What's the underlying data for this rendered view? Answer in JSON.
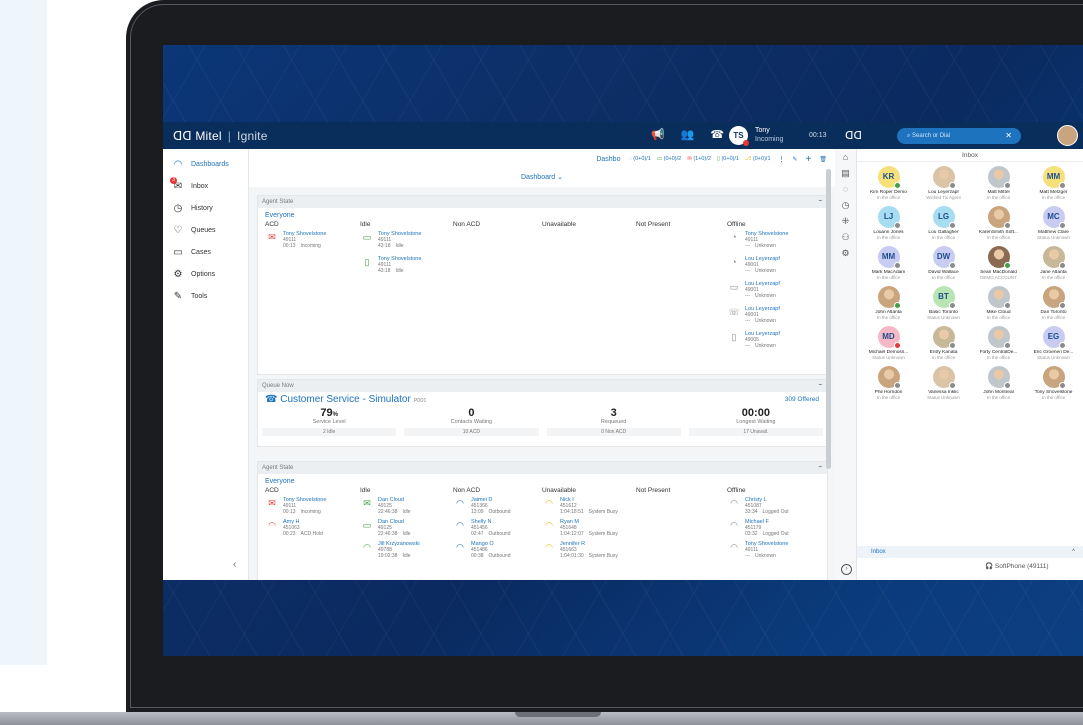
{
  "app": {
    "brand": "Mitel",
    "product": "Ignite",
    "user_initials": "TS",
    "user_name": "Tony",
    "user_status": "Incoming",
    "clock": "00:13"
  },
  "nav": [
    {
      "label": "Dashboards",
      "icon": "dashboard-icon",
      "glyph": "◠",
      "active": true
    },
    {
      "label": "Inbox",
      "icon": "inbox-icon",
      "glyph": "✉",
      "badge": "3"
    },
    {
      "label": "History",
      "icon": "history-icon",
      "glyph": "◷"
    },
    {
      "label": "Queues",
      "icon": "queues-icon",
      "glyph": "♡"
    },
    {
      "label": "Cases",
      "icon": "cases-icon",
      "glyph": "▭"
    },
    {
      "label": "Options",
      "icon": "options-icon",
      "glyph": "⚙"
    },
    {
      "label": "Tools",
      "icon": "tools-icon",
      "glyph": "✎"
    }
  ],
  "header": {
    "tab": "Dashbo",
    "counters": [
      "(0+0)/1",
      "(0+0)/2",
      "(1+0)/2",
      "(0+0)/1",
      "(0+0)/1"
    ],
    "subtitle": "Dashboard"
  },
  "panel1": {
    "title": "Agent State",
    "group": "Everyone",
    "columns": [
      "ACD",
      "Idle",
      "Non ACD",
      "Unavailable",
      "Not Present",
      "Offline"
    ],
    "acd": [
      {
        "name": "Tony Shovelstone",
        "ext": "49111",
        "t": "00:13",
        "s": "Incoming",
        "color": "#e53935",
        "glyph": "✉"
      }
    ],
    "idle": [
      {
        "name": "Tony Shovelstone",
        "ext": "49111",
        "t": "43:18",
        "s": "Idle",
        "color": "#43a047",
        "glyph": "▭"
      },
      {
        "name": "Tony Shovelstone",
        "ext": "49111",
        "t": "43:18",
        "s": "Idle",
        "color": "#43a047",
        "glyph": "▯"
      }
    ],
    "offline": [
      {
        "name": "Tony Shovelstone",
        "ext": "49111",
        "t": "---",
        "s": "Unknown",
        "glyph": "◔"
      },
      {
        "name": "Lou Leyerzapf",
        "ext": "49001",
        "t": "---",
        "s": "Unknown",
        "glyph": "◔"
      },
      {
        "name": "Lou Leyerzapf",
        "ext": "49001",
        "t": "---",
        "s": "Unknown",
        "glyph": "▭"
      },
      {
        "name": "Lou Leyerzapf",
        "ext": "49001",
        "t": "---",
        "s": "Unknown",
        "glyph": "☏"
      },
      {
        "name": "Lou Leyerzapf",
        "ext": "49005",
        "t": "---",
        "s": "Unknown",
        "glyph": "▯"
      }
    ]
  },
  "queue": {
    "panel_title": "Queue Now",
    "name": "Customer Service - Simulator",
    "code": "P001",
    "offered": "309 Offered",
    "stats": [
      {
        "num": "79",
        "unit": "%",
        "label": "Service Level",
        "sub": "2 Idle"
      },
      {
        "num": "0",
        "unit": "",
        "label": "Contacts Waiting",
        "sub": "10 ACD"
      },
      {
        "num": "3",
        "unit": "",
        "label": "Requeued",
        "sub": "0 Non ACD"
      },
      {
        "num": "00:00",
        "unit": "",
        "label": "Longest Waiting",
        "sub": "17 Unavail."
      }
    ]
  },
  "panel3": {
    "title": "Agent State",
    "group": "Everyone",
    "columns": [
      "ACD",
      "Idle",
      "Non ACD",
      "Unavailable",
      "Not Present",
      "Offline"
    ],
    "acd": [
      {
        "name": "Tony Shovelstone",
        "ext": "49111",
        "t": "00:13",
        "s": "Incoming",
        "color": "#e53935",
        "glyph": "✉"
      },
      {
        "name": "Amy H",
        "ext": "451063",
        "t": "00:23",
        "s": "ACD Hold",
        "color": "#e53935",
        "glyph": "◠"
      }
    ],
    "idle": [
      {
        "name": "Dan Cloud",
        "ext": "49125",
        "t": "22:46:38",
        "s": "Idle",
        "color": "#43a047",
        "glyph": "✉"
      },
      {
        "name": "Dan Cloud",
        "ext": "49125",
        "t": "22:46:38",
        "s": "Idle",
        "color": "#43a047",
        "glyph": "▭"
      },
      {
        "name": "Jill Krzyzanowski",
        "ext": "49788",
        "t": "19:02:38",
        "s": "Idle",
        "color": "#43a047",
        "glyph": "◠"
      }
    ],
    "nonacd": [
      {
        "name": "Jaimei D",
        "ext": "451366",
        "t": "13:09",
        "s": "Outbound",
        "color": "#1e73be",
        "glyph": "◠"
      },
      {
        "name": "Shelly N",
        "ext": "451456",
        "t": "02:47",
        "s": "Outbound",
        "color": "#1e73be",
        "glyph": "◠"
      },
      {
        "name": "Mango O",
        "ext": "451486",
        "t": "00:38",
        "s": "Outbound",
        "color": "#1e73be",
        "glyph": "◠"
      }
    ],
    "unavail": [
      {
        "name": "Nick I",
        "ext": "451612",
        "t": "1:04:18:51",
        "s": "System Busy",
        "color": "#f2b705",
        "glyph": "◠"
      },
      {
        "name": "Ryan M",
        "ext": "451648",
        "t": "1:04:12:07",
        "s": "System Busy",
        "color": "#f2b705",
        "glyph": "◠"
      },
      {
        "name": "Jennifer R",
        "ext": "451663",
        "t": "1:04:01:30",
        "s": "System Busy",
        "color": "#f2b705",
        "glyph": "◠"
      }
    ],
    "offline": [
      {
        "name": "Christy L",
        "ext": "451087",
        "t": "33:34",
        "s": "Logged Out",
        "glyph": "◠"
      },
      {
        "name": "Michael F",
        "ext": "451179",
        "t": "03:32",
        "s": "Logged Out",
        "glyph": "◠"
      },
      {
        "name": "Tony Shovelstone",
        "ext": "49111",
        "t": "---",
        "s": "Unknown",
        "glyph": "◠"
      }
    ]
  },
  "rightpanel": {
    "search_placeholder": "Search or Dial",
    "title": "Inbox",
    "footer": "Inbox",
    "softphone": "SoftPhone (49111)",
    "contacts": [
      {
        "name": "Kim Roper Demo",
        "status": "In the office",
        "init": "KR",
        "bg": "#f6e07a",
        "dot": "#43a047"
      },
      {
        "name": "Lou Leyerzapf",
        "status": "Wicked Tix Agent",
        "init": "",
        "bg": "#d9c4a8",
        "dot": "#8c8c8c"
      },
      {
        "name": "Matt Mittel",
        "status": "In the office",
        "init": "",
        "bg": "#bfc6cc",
        "dot": "#8c8c8c"
      },
      {
        "name": "Matt Metzger",
        "status": "In the office",
        "init": "MM",
        "bg": "#f6e07a",
        "dot": "#8c8c8c"
      },
      {
        "name": "Louann Jones",
        "status": "In the office",
        "init": "LJ",
        "bg": "#a8dcf0",
        "dot": "#8c8c8c"
      },
      {
        "name": "Lou Gallagher",
        "status": "In the office",
        "init": "LG",
        "bg": "#a8dcf0",
        "dot": "#8c8c8c"
      },
      {
        "name": "KarenSmith Soft...",
        "status": "In the office",
        "init": "",
        "bg": "#c8a57e",
        "dot": "#8c8c8c"
      },
      {
        "name": "Matthew Clare",
        "status": "Status Unknown",
        "init": "MC",
        "bg": "#c9ccf2",
        "dot": "#8c8c8c"
      },
      {
        "name": "Mark MacAdam",
        "status": "In the office",
        "init": "MM",
        "bg": "#c9ccf2",
        "dot": "#8c8c8c"
      },
      {
        "name": "David Wallace",
        "status": "In the office",
        "init": "DW",
        "bg": "#c9ccf2",
        "dot": "#8c8c8c"
      },
      {
        "name": "Sean MacDonald",
        "status": "DEMO ACCOUNT",
        "init": "",
        "bg": "#8a6b52",
        "dot": "#43a047"
      },
      {
        "name": "Jane Atlanta",
        "status": "In the office",
        "init": "",
        "bg": "#c8b89a",
        "dot": "#8c8c8c"
      },
      {
        "name": "John Atlanta",
        "status": "In the office",
        "init": "",
        "bg": "#c8a57e",
        "dot": "#43a047"
      },
      {
        "name": "Basic Toronto",
        "status": "Status Unknown",
        "init": "BT",
        "bg": "#b9e4b3",
        "dot": "#8c8c8c"
      },
      {
        "name": "Mike Cloud",
        "status": "In the office",
        "init": "",
        "bg": "#bfc6cc",
        "dot": "#8c8c8c"
      },
      {
        "name": "Dan Toronto",
        "status": "In the office",
        "init": "",
        "bg": "#c8a57e",
        "dot": "#8c8c8c"
      },
      {
        "name": "Michael Demoss...",
        "status": "Status Unknown",
        "init": "MD",
        "bg": "#f5b8c6",
        "dot": "#e53935"
      },
      {
        "name": "Entry Kanata",
        "status": "In the office",
        "init": "",
        "bg": "#c8b89a",
        "dot": "#8c8c8c"
      },
      {
        "name": "Forty CentralDe...",
        "status": "In the office",
        "init": "",
        "bg": "#bfc6cc",
        "dot": "#8c8c8c"
      },
      {
        "name": "Eric Groenen De...",
        "status": "Status Unknown",
        "init": "EG",
        "bg": "#c9ccf2",
        "dot": "#8c8c8c"
      },
      {
        "name": "Phil Horndon",
        "status": "In the office",
        "init": "",
        "bg": "#c8a57e",
        "dot": "#8c8c8c"
      },
      {
        "name": "Vanessa Inklic",
        "status": "Status Unknown",
        "init": "",
        "bg": "#d9c4a8",
        "dot": "#8c8c8c"
      },
      {
        "name": "John Montreal",
        "status": "In the office",
        "init": "",
        "bg": "#bfc6cc",
        "dot": "#8c8c8c"
      },
      {
        "name": "Tony Shovelstone",
        "status": "In the office",
        "init": "",
        "bg": "#c8a57e",
        "dot": "#8c8c8c"
      }
    ]
  }
}
